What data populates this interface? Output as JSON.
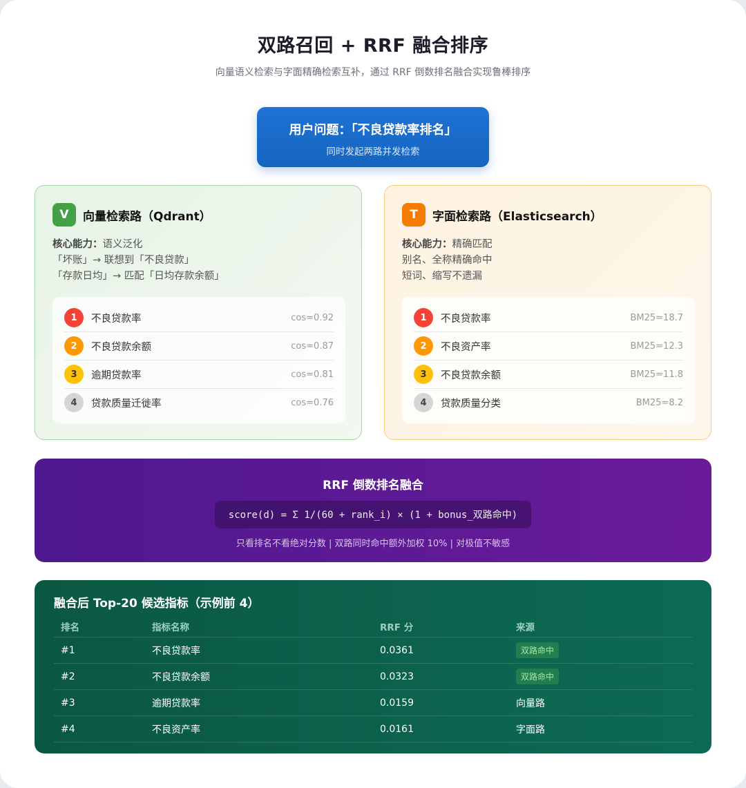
{
  "header": {
    "title": "双路召回 + RRF 融合排序",
    "subtitle": "向量语义检索与字面精确检索互补，通过 RRF 倒数排名融合实现鲁棒排序"
  },
  "query": {
    "main": "用户问题：「不良贷款率排名」",
    "sub": "同时发起两路并发检索"
  },
  "vector_path": {
    "badge": "V",
    "title": "向量检索路（Qdrant）",
    "ability_label": "核心能力：",
    "ability_value": "语义泛化",
    "lines": [
      "「坏账」→ 联想到「不良贷款」",
      "「存款日均」→ 匹配「日均存款余额」"
    ],
    "color": "#43a047",
    "results": [
      {
        "rank": "1",
        "name": "不良贷款率",
        "score": "cos=0.92"
      },
      {
        "rank": "2",
        "name": "不良贷款余额",
        "score": "cos=0.87"
      },
      {
        "rank": "3",
        "name": "逾期贷款率",
        "score": "cos=0.81"
      },
      {
        "rank": "4",
        "name": "贷款质量迁徙率",
        "score": "cos=0.76"
      }
    ]
  },
  "text_path": {
    "badge": "T",
    "title": "字面检索路（Elasticsearch）",
    "ability_label": "核心能力：",
    "ability_value": "精确匹配",
    "lines": [
      "别名、全称精确命中",
      "短词、缩写不遗漏"
    ],
    "color": "#f57c00",
    "results": [
      {
        "rank": "1",
        "name": "不良贷款率",
        "score": "BM25=18.7"
      },
      {
        "rank": "2",
        "name": "不良资产率",
        "score": "BM25=12.3"
      },
      {
        "rank": "3",
        "name": "不良贷款余额",
        "score": "BM25=11.8"
      },
      {
        "rank": "4",
        "name": "贷款质量分类",
        "score": "BM25=8.2"
      }
    ]
  },
  "rrf": {
    "title": "RRF 倒数排名融合",
    "formula": "score(d) = Σ 1/(60 + rank_i) × (1 + bonus_双路命中)",
    "note": "只看排名不看绝对分数 | 双路同时命中额外加权 10% | 对极值不敏感"
  },
  "result": {
    "title": "融合后 Top-20 候选指标（示例前 4）",
    "columns": [
      "排名",
      "指标名称",
      "RRF 分",
      "来源"
    ],
    "rows": [
      {
        "rank": "#1",
        "name": "不良贷款率",
        "score": "0.0361",
        "source": "双路命中",
        "hit": true
      },
      {
        "rank": "#2",
        "name": "不良贷款余额",
        "score": "0.0323",
        "source": "双路命中",
        "hit": true
      },
      {
        "rank": "#3",
        "name": "逾期贷款率",
        "score": "0.0159",
        "source": "向量路",
        "hit": false
      },
      {
        "rank": "#4",
        "name": "不良资产率",
        "score": "0.0161",
        "source": "字面路",
        "hit": false
      }
    ]
  }
}
